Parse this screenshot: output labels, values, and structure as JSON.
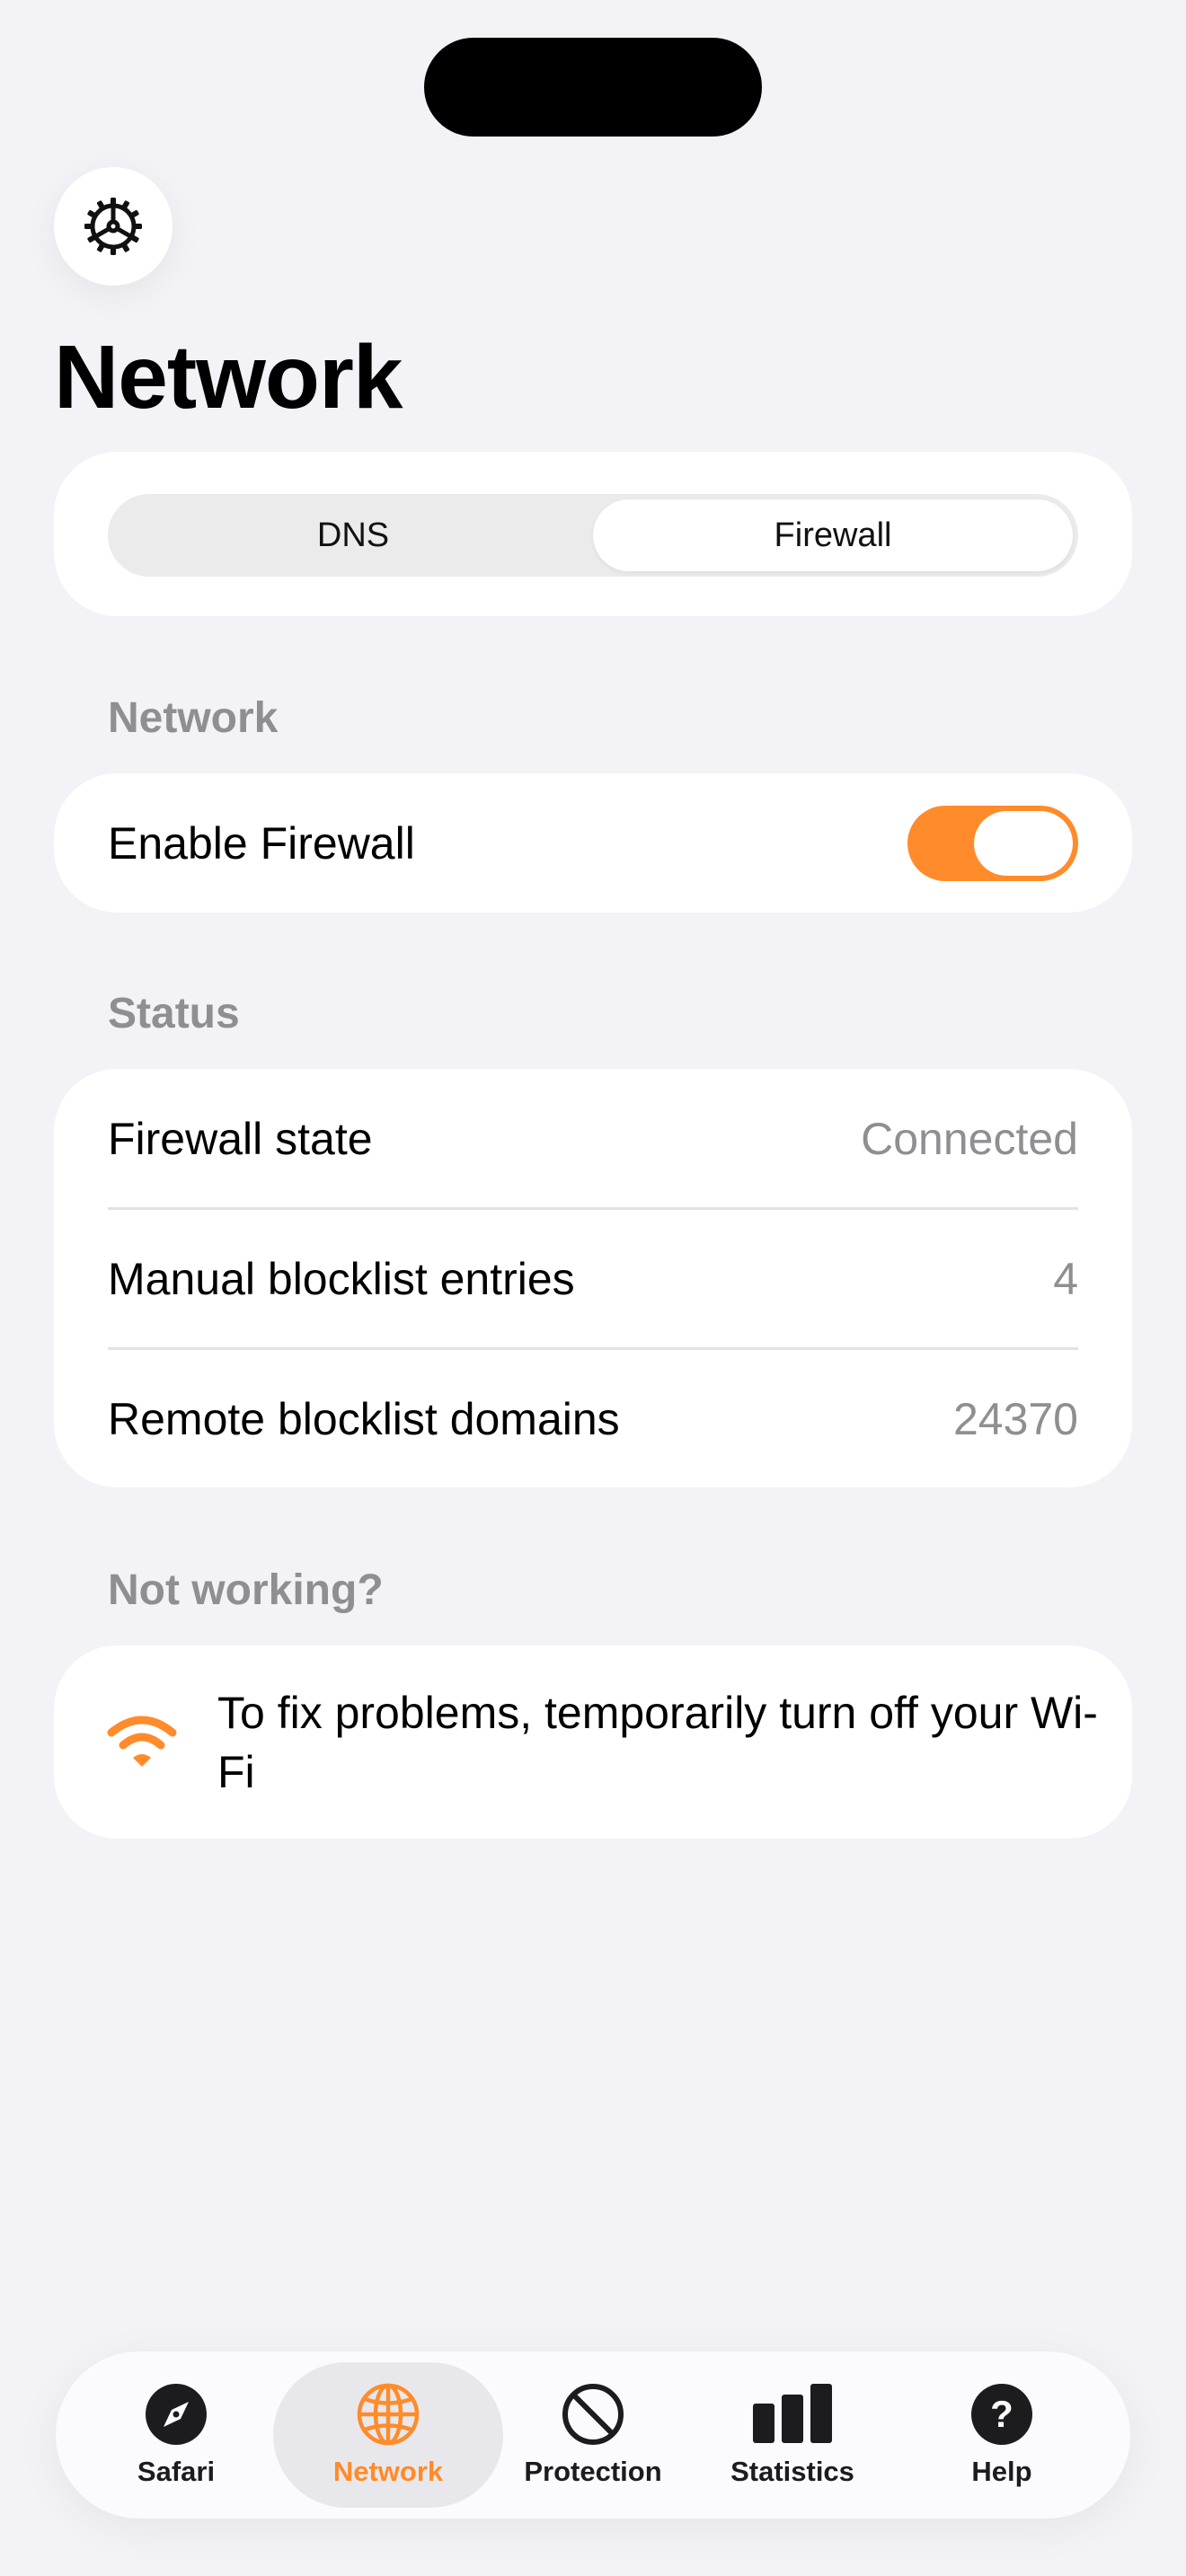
{
  "header": {
    "title": "Network"
  },
  "segmented": {
    "options": [
      "DNS",
      "Firewall"
    ],
    "selected": "Firewall"
  },
  "network_section": {
    "header": "Network",
    "enable_firewall_label": "Enable Firewall",
    "enable_firewall_on": true
  },
  "status_section": {
    "header": "Status",
    "rows": [
      {
        "label": "Firewall state",
        "value": "Connected"
      },
      {
        "label": "Manual blocklist entries",
        "value": "4"
      },
      {
        "label": "Remote blocklist domains",
        "value": "24370"
      }
    ]
  },
  "help_section": {
    "header": "Not working?",
    "text": "To fix problems, temporarily turn off your Wi-Fi",
    "icon": "wifi-icon"
  },
  "tabbar": {
    "tabs": [
      {
        "label": "Safari",
        "icon": "compass-icon"
      },
      {
        "label": "Network",
        "icon": "globe-icon"
      },
      {
        "label": "Protection",
        "icon": "prohibit-icon"
      },
      {
        "label": "Statistics",
        "icon": "bar-chart-icon"
      },
      {
        "label": "Help",
        "icon": "question-icon"
      }
    ],
    "selected": "Network"
  },
  "colors": {
    "accent": "#ff8b2a",
    "background": "#f2f2f7",
    "secondary_text": "#8e8e93"
  }
}
